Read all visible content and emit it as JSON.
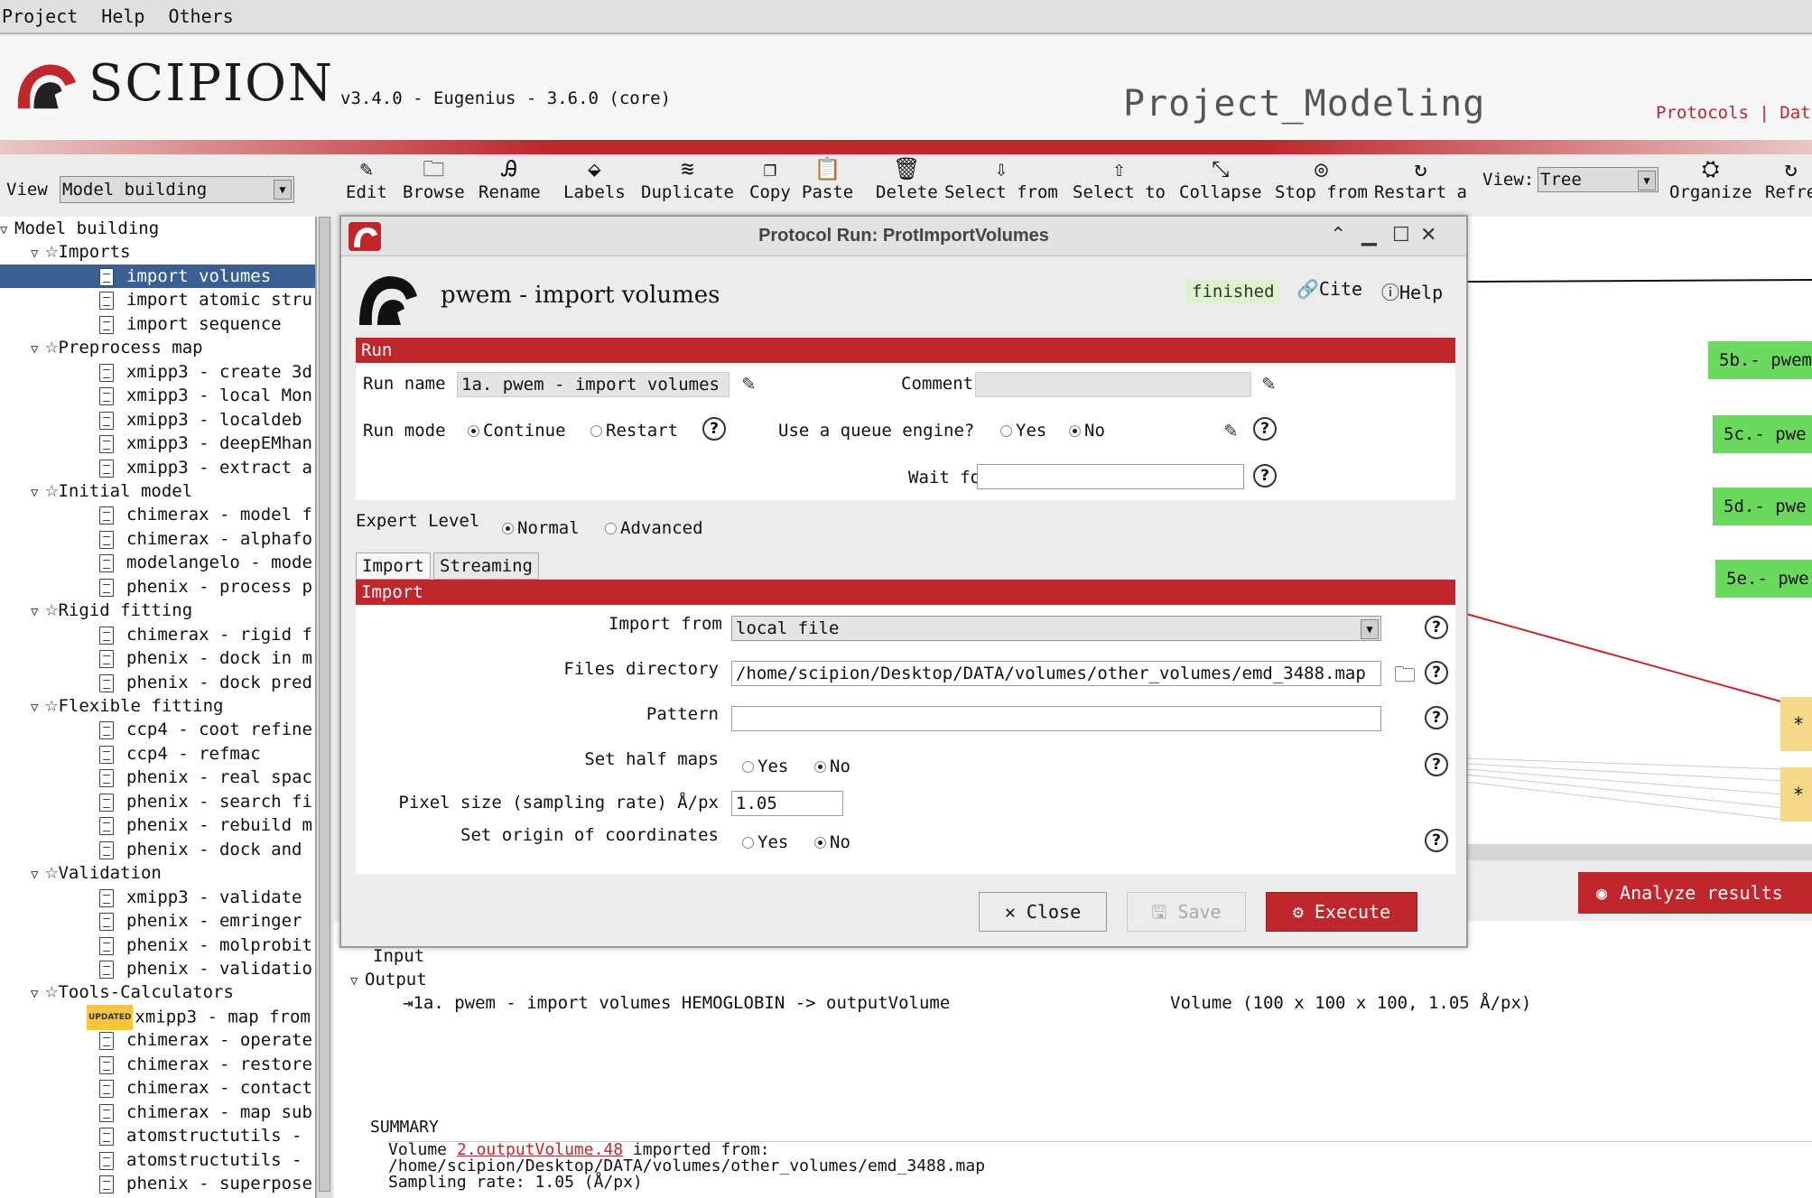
{
  "menu": [
    "Project",
    "Help",
    "Others"
  ],
  "header": {
    "brand": "SCIPION",
    "version": "v3.4.0 - Eugenius - 3.6.0 (core)",
    "project_name": "Project_Modeling",
    "links": "Protocols  |  Dat"
  },
  "view": {
    "label": "View",
    "value": "Model building"
  },
  "toolbar": {
    "items": [
      {
        "label": "Edit",
        "icon": "pencil-icon",
        "glyph": "✎"
      },
      {
        "label": "Browse",
        "icon": "folder-open-icon",
        "glyph": "🗀"
      },
      {
        "label": "Rename",
        "icon": "rename-icon",
        "glyph": "Ꭿ"
      },
      {
        "label": "Labels",
        "icon": "tag-icon",
        "glyph": "⬙"
      },
      {
        "label": "Duplicate",
        "icon": "layers-icon",
        "glyph": "≋"
      },
      {
        "label": "Copy",
        "icon": "copy-icon",
        "glyph": "❐"
      },
      {
        "label": "Paste",
        "icon": "clipboard-icon",
        "glyph": "📋"
      },
      {
        "label": "Delete",
        "icon": "trash-icon",
        "glyph": "🗑"
      },
      {
        "label": "Select from",
        "icon": "arrow-down-icon",
        "glyph": "⇩"
      },
      {
        "label": "Select to",
        "icon": "arrow-up-icon",
        "glyph": "⇧"
      },
      {
        "label": "Collapse",
        "icon": "collapse-icon",
        "glyph": "⤡"
      },
      {
        "label": "Stop from",
        "icon": "stop-icon",
        "glyph": "◎"
      },
      {
        "label": "Restart a",
        "icon": "restart-icon",
        "glyph": "↻"
      }
    ],
    "view_label": "View:",
    "view_value": "Tree",
    "organize": "Organize",
    "refresh": "Refre"
  },
  "tree": {
    "root": "Model building",
    "rows": [
      {
        "kind": "group",
        "label": "Imports"
      },
      {
        "kind": "leaf",
        "label": "import volumes",
        "selected": true
      },
      {
        "kind": "leaf",
        "label": "import atomic stru"
      },
      {
        "kind": "leaf",
        "label": "import sequence"
      },
      {
        "kind": "group",
        "label": "Preprocess map"
      },
      {
        "kind": "leaf",
        "label": "xmipp3 - create 3d"
      },
      {
        "kind": "leaf",
        "label": "xmipp3 - local Mon"
      },
      {
        "kind": "leaf",
        "label": "xmipp3 - localdeb"
      },
      {
        "kind": "leaf",
        "label": "xmipp3 - deepEMhan"
      },
      {
        "kind": "leaf",
        "label": "xmipp3 - extract a"
      },
      {
        "kind": "group",
        "label": "Initial model"
      },
      {
        "kind": "leaf",
        "label": "chimerax - model f"
      },
      {
        "kind": "leaf",
        "label": "chimerax - alphafo"
      },
      {
        "kind": "leaf",
        "label": "modelangelo - mode"
      },
      {
        "kind": "leaf",
        "label": "phenix - process p"
      },
      {
        "kind": "group",
        "label": "Rigid fitting"
      },
      {
        "kind": "leaf",
        "label": "chimerax - rigid f"
      },
      {
        "kind": "leaf",
        "label": "phenix - dock in m"
      },
      {
        "kind": "leaf",
        "label": "phenix - dock pred"
      },
      {
        "kind": "group",
        "label": "Flexible fitting"
      },
      {
        "kind": "leaf",
        "label": "ccp4 - coot refine"
      },
      {
        "kind": "leaf",
        "label": "ccp4 - refmac"
      },
      {
        "kind": "leaf",
        "label": "phenix - real spac"
      },
      {
        "kind": "leaf",
        "label": "phenix - search fi"
      },
      {
        "kind": "leaf",
        "label": "phenix - rebuild m"
      },
      {
        "kind": "leaf",
        "label": "phenix - dock and"
      },
      {
        "kind": "group",
        "label": "Validation"
      },
      {
        "kind": "leaf",
        "label": "xmipp3 - validate"
      },
      {
        "kind": "leaf",
        "label": "phenix - emringer"
      },
      {
        "kind": "leaf",
        "label": "phenix - molprobit"
      },
      {
        "kind": "leaf",
        "label": "phenix - validatio"
      },
      {
        "kind": "group",
        "label": "Tools-Calculators"
      },
      {
        "kind": "leaf",
        "label": "xmipp3 - map from",
        "badge": "UPDATED"
      },
      {
        "kind": "leaf",
        "label": "chimerax - operate"
      },
      {
        "kind": "leaf",
        "label": "chimerax - restore"
      },
      {
        "kind": "leaf",
        "label": "chimerax - contact"
      },
      {
        "kind": "leaf",
        "label": "chimerax - map sub"
      },
      {
        "kind": "leaf",
        "label": "atomstructutils -"
      },
      {
        "kind": "leaf",
        "label": "atomstructutils -"
      },
      {
        "kind": "leaf",
        "label": "phenix - superpose"
      }
    ]
  },
  "graph": {
    "nodes": [
      "5b.- pwem",
      "5c.- pwe",
      "5d.- pwe",
      "5e.- pwe"
    ],
    "stars": [
      "*",
      "*"
    ]
  },
  "analyze": "Analyze results",
  "output": {
    "input_label": "Input",
    "output_label": "Output",
    "row": "1a. pwem - import volumes HEMOGLOBIN -> outputVolume",
    "row_info": "Volume (100 x 100 x 100, 1.05 Å/px)",
    "summary_title": "SUMMARY",
    "summary_pre": "Volume ",
    "summary_link": "2.outputVolume.48",
    "summary_post": " imported from:",
    "summary_path": "/home/scipion/Desktop/DATA/volumes/other_volumes/emd_3488.map",
    "summary_rate": "Sampling rate: 1.05 (Å/px)"
  },
  "dialog": {
    "title": "Protocol Run: ProtImportVolumes",
    "protocol": "pwem - import volumes",
    "status": "finished",
    "cite": "Cite",
    "help": "Help",
    "run_header": "Run",
    "run_name_label": "Run name",
    "run_name": "1a. pwem - import volumes",
    "comment_label": "Comment",
    "comment": "",
    "run_mode_label": "Run mode",
    "run_mode_opts": [
      "Continue",
      "Restart"
    ],
    "queue_label": "Use a queue engine?",
    "queue_opts": [
      "Yes",
      "No"
    ],
    "wait_label": "Wait for",
    "wait_value": "",
    "expert_label": "Expert Level",
    "expert_opts": [
      "Normal",
      "Advanced"
    ],
    "tabs": [
      "Import",
      "Streaming"
    ],
    "import_header": "Import",
    "import_from_label": "Import from",
    "import_from": "local file",
    "files_dir_label": "Files directory",
    "files_dir": "/home/scipion/Desktop/DATA/volumes/other_volumes/emd_3488.map",
    "pattern_label": "Pattern",
    "pattern": "",
    "half_maps_label": "Set half maps",
    "yes": "Yes",
    "no": "No",
    "pixel_label": "Pixel size (sampling rate) Å/px",
    "pixel": "1.05",
    "origin_label": "Set origin of coordinates",
    "close": "Close",
    "save": "Save",
    "execute": "Execute"
  }
}
